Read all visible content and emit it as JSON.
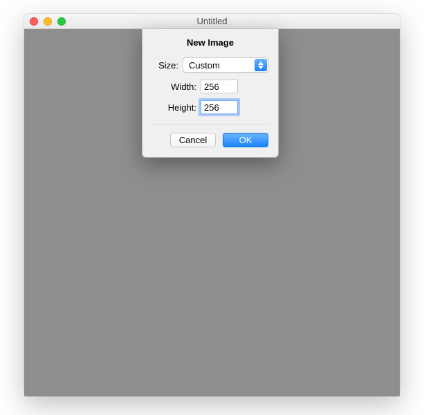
{
  "window": {
    "title": "Untitled"
  },
  "sheet": {
    "title": "New Image",
    "size_label": "Size:",
    "size_value": "Custom",
    "width_label": "Width:",
    "width_value": "256",
    "height_label": "Height:",
    "height_value": "256",
    "cancel": "Cancel",
    "ok": "OK"
  }
}
